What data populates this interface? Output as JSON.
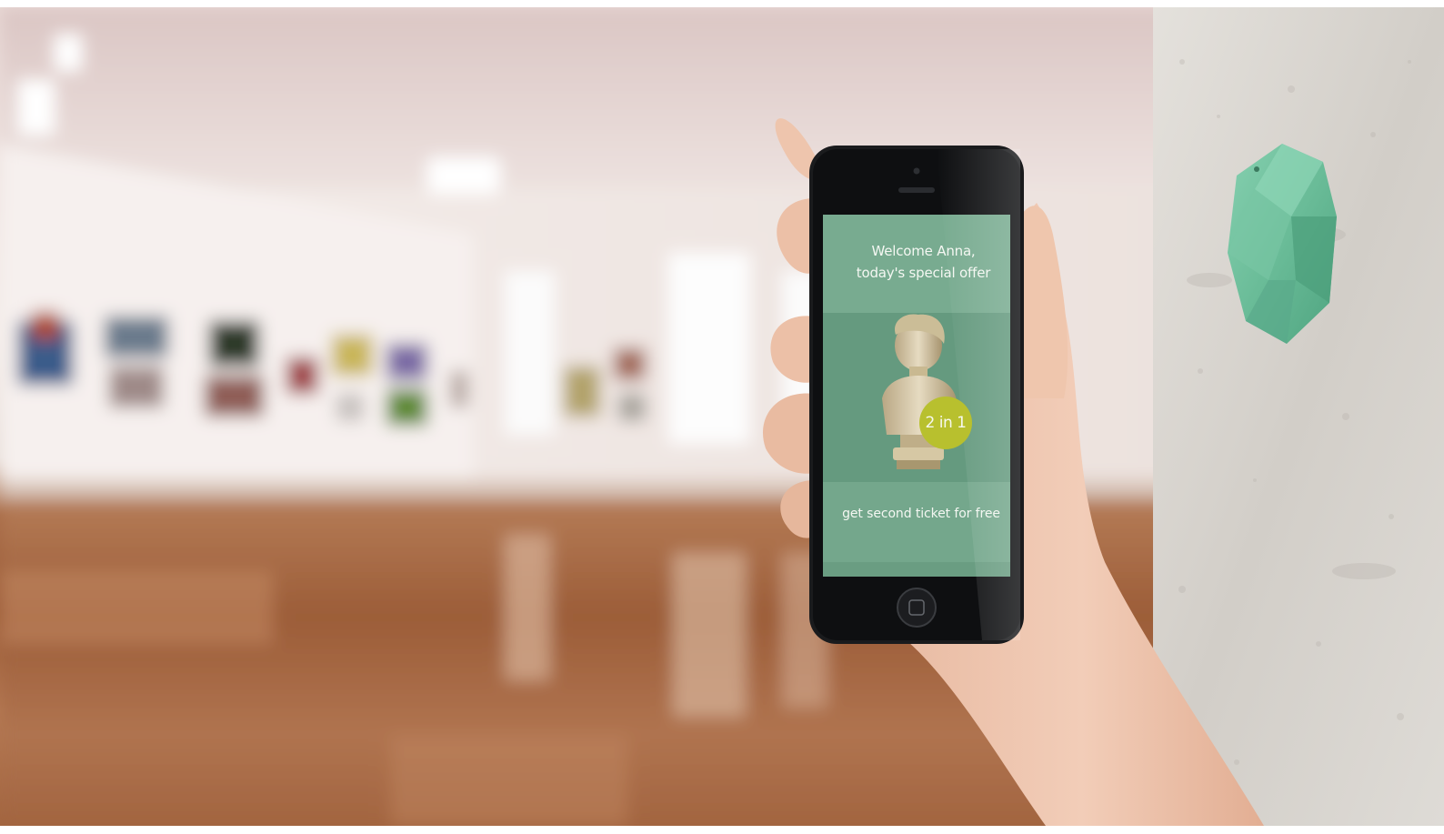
{
  "photo": {
    "scene": "art gallery with hand holding smartphone near wall-mounted beacon",
    "colors": {
      "screen_green": "#6fa287",
      "screen_green_dark": "#5c8f75",
      "badge_yellow": "#b8c02e",
      "beacon_mint": "#6fbf9d",
      "floor_wood": "#a86b47",
      "wall_concrete": "#d9d6d0"
    }
  },
  "phone_app": {
    "welcome_line_1": "Welcome Anna,",
    "welcome_line_2": "today's special offer",
    "badge_text": "2 in 1",
    "offer_text": "get second ticket for free"
  }
}
